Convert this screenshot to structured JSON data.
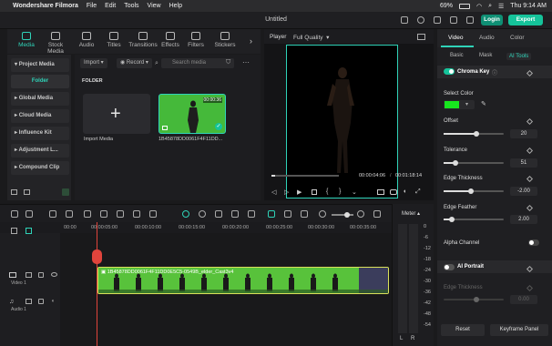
{
  "menubar": {
    "app": "Wondershare Filmora",
    "items": [
      "File",
      "Edit",
      "Tools",
      "View",
      "Help"
    ],
    "battery": "69%",
    "clock": "Thu 9:14 AM"
  },
  "titlebar": {
    "title": "Untitled",
    "login": "Login",
    "export": "Export"
  },
  "media_tabs": [
    "Media",
    "Stock Media",
    "Audio",
    "Titles",
    "Transitions",
    "Effects",
    "Filters",
    "Stickers"
  ],
  "left_nav": [
    "Project Media",
    "Folder",
    "Global Media",
    "Cloud Media",
    "Influence Kit",
    "Adjustment L...",
    "Compound Clip"
  ],
  "media_toolbar": {
    "import": "Import",
    "record": "Record",
    "search_placeholder": "Search media"
  },
  "media": {
    "folder_label": "FOLDER",
    "import_label": "Import Media",
    "clip_name": "1B45878DD0061F4F11DD...",
    "clip_duration": "00:00:36"
  },
  "player": {
    "label": "Player",
    "quality": "Full Quality",
    "current": "00:00:04:06",
    "total": "00:01:18:14",
    "progress": 0.05
  },
  "inspector": {
    "tabs": [
      "Video",
      "Audio",
      "Color"
    ],
    "sub_tabs": [
      "Basic",
      "Mask",
      "AI Tools"
    ],
    "chroma_key": "Chroma Key",
    "select_color": "Select Color",
    "key_color": "#17e61e",
    "offset": {
      "label": "Offset",
      "value": "20"
    },
    "tolerance": {
      "label": "Tolerance",
      "value": "51"
    },
    "edge_thickness": {
      "label": "Edge Thickness",
      "value": "-2.00"
    },
    "edge_feather": {
      "label": "Edge Feather",
      "value": "2.00"
    },
    "alpha_channel": "Alpha Channel",
    "ai_portrait": "AI Portrait",
    "ai_edge_thickness": {
      "label": "Edge Thickness",
      "value": "0.00"
    },
    "reset": "Reset",
    "keyframe": "Keyframe Panel"
  },
  "timeline": {
    "ruler": [
      "00:00",
      "00:00:05:00",
      "00:00:10:00",
      "00:00:15:00",
      "00:00:20:00",
      "00:00:25:00",
      "00:00:30:00",
      "00:00:35:00"
    ],
    "video_track": "Video 1",
    "audio_track": "Audio 1",
    "clip_title": "1B45878DD0061F4F11DD0E5C5-0549B_elder_Cast3v4"
  },
  "meter": {
    "label": "Meter",
    "scale": [
      "0",
      "-6",
      "-12",
      "-18",
      "-24",
      "-30",
      "-36",
      "-42",
      "-48",
      "-54"
    ],
    "left": "L",
    "right": "R"
  },
  "colors": {
    "accent": "#2fd3b8",
    "export": "#15c39a",
    "clip_border": "#d9e05a",
    "playhead": "#e0443c"
  }
}
